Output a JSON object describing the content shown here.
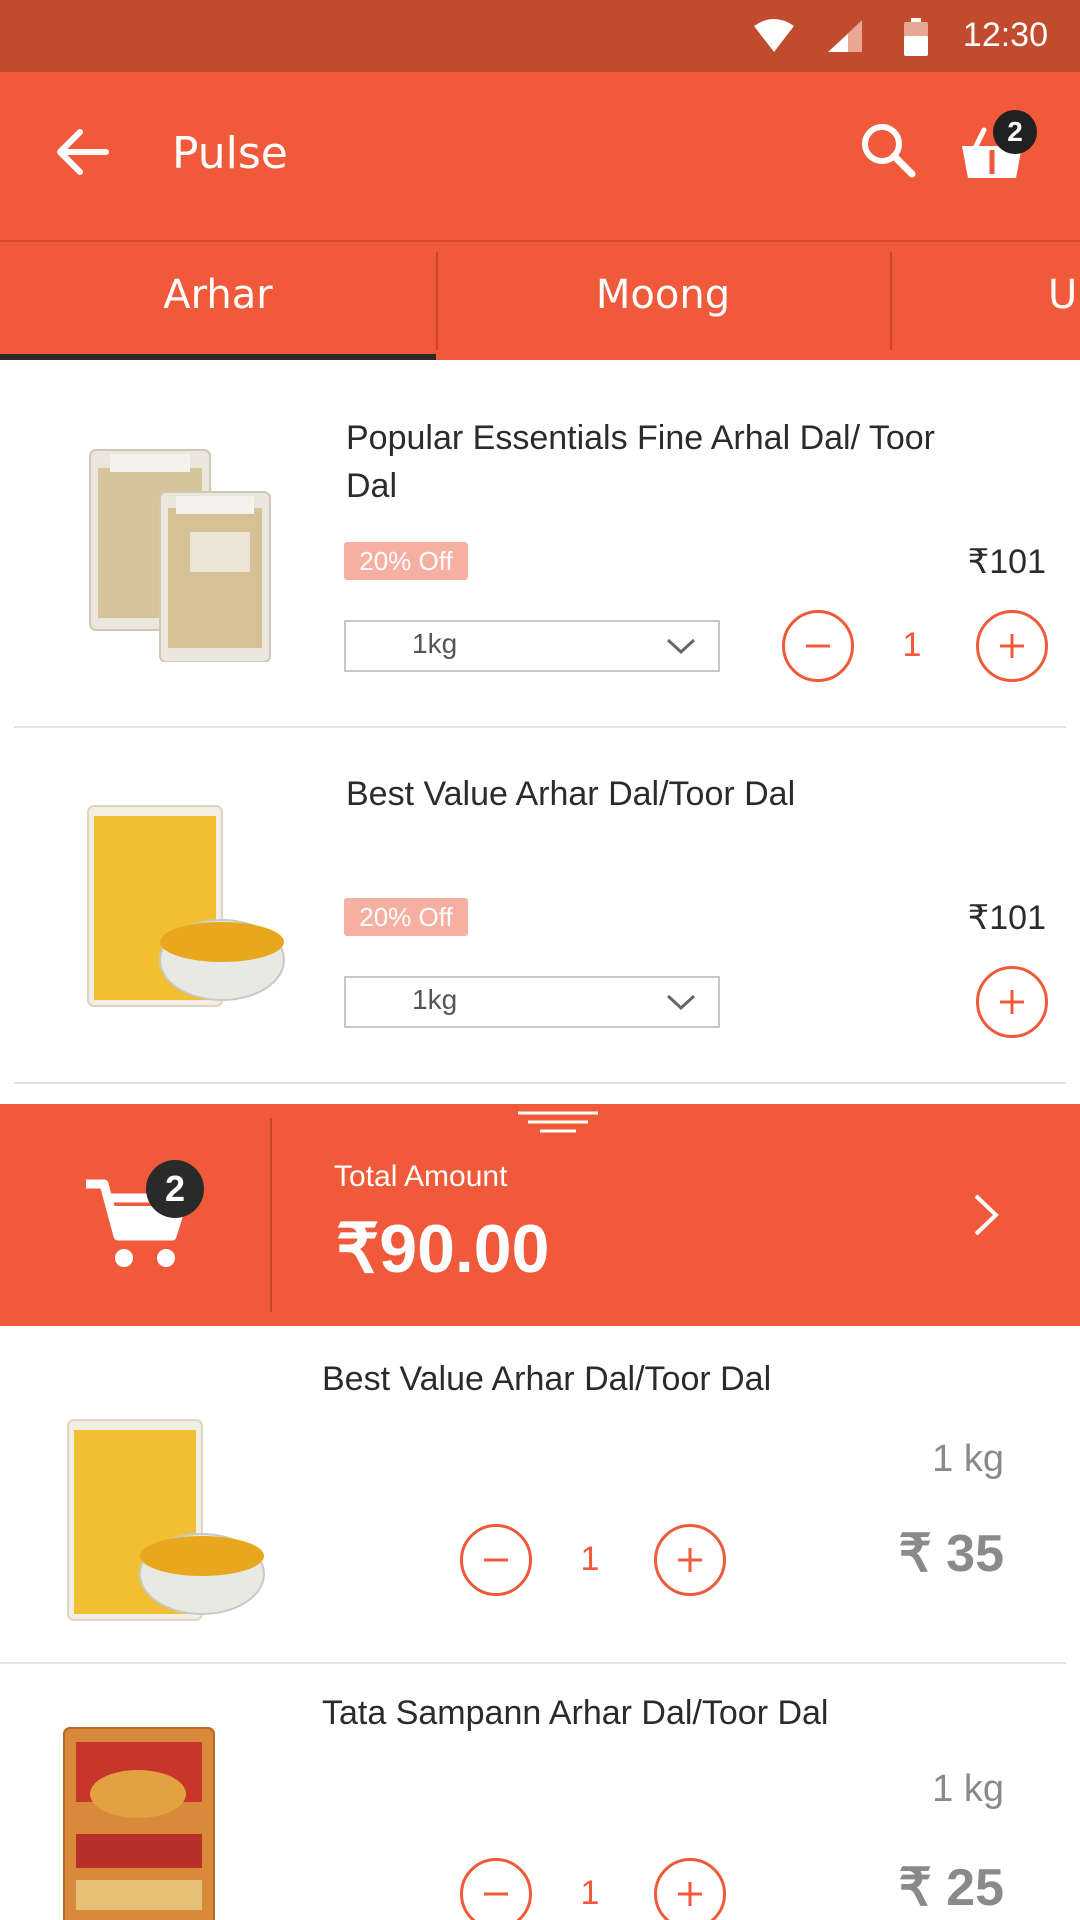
{
  "status_bar": {
    "time": "12:30"
  },
  "app_bar": {
    "title": "Pulse",
    "cart_count": "2"
  },
  "tabs": [
    {
      "label": "Arhar"
    },
    {
      "label": "Moong"
    },
    {
      "label": "U"
    }
  ],
  "products": [
    {
      "title": "Popular Essentials Fine Arhal Dal/ Toor Dal",
      "discount": "20% Off",
      "price": "₹101",
      "weight": "1kg",
      "quantity": "1"
    },
    {
      "title": "Best Value Arhar Dal/Toor Dal",
      "discount": "20% Off",
      "price": "₹101",
      "weight": "1kg"
    }
  ],
  "total_bar": {
    "cart_count": "2",
    "label": "Total Amount",
    "amount": "₹90.00"
  },
  "cart_items": [
    {
      "title": "Best Value Arhar Dal/Toor Dal",
      "weight": "1 kg",
      "quantity": "1",
      "price": "₹ 35"
    },
    {
      "title": "Tata Sampann Arhar Dal/Toor Dal",
      "weight": "1 kg",
      "quantity": "1",
      "price": "₹ 25"
    }
  ],
  "colors": {
    "primary": "#f05a3b",
    "status_bar": "#c24a2d",
    "badge": "#212121",
    "discount_bg": "#f6b0a2"
  },
  "icons": [
    "wifi-icon",
    "signal-icon",
    "battery-icon",
    "back-arrow-icon",
    "search-icon",
    "basket-icon",
    "chevron-down-icon",
    "minus-icon",
    "plus-icon",
    "cart-icon",
    "drag-handle-icon",
    "chevron-right-icon"
  ]
}
